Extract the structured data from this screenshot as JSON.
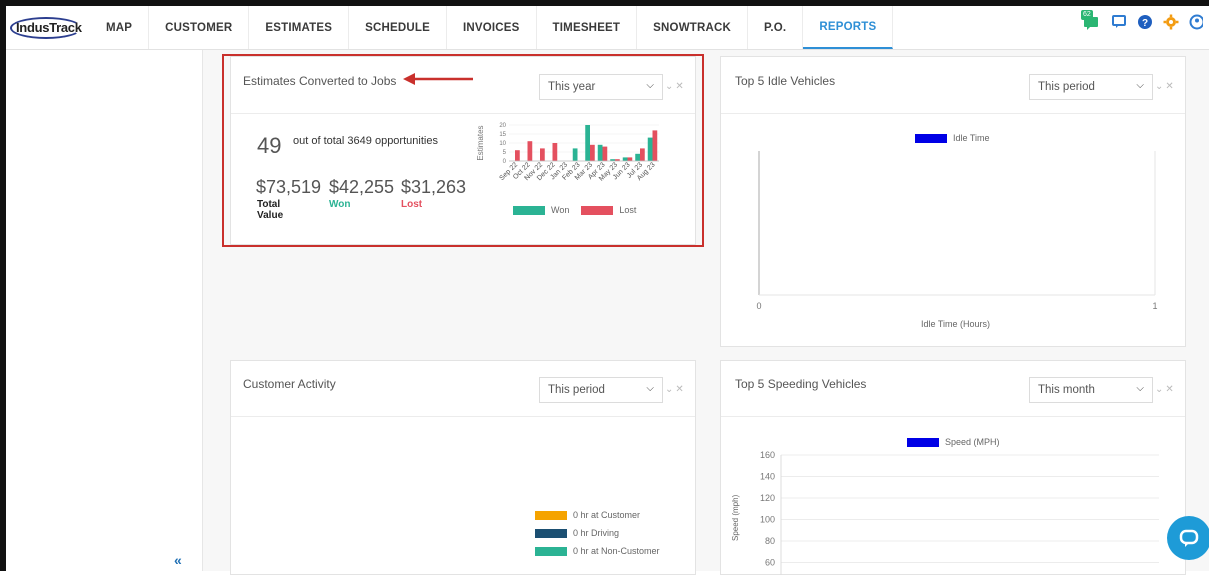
{
  "app": {
    "logo_text": "IndusTrack"
  },
  "nav": {
    "items": [
      {
        "label": "MAP"
      },
      {
        "label": "CUSTOMER"
      },
      {
        "label": "ESTIMATES"
      },
      {
        "label": "SCHEDULE"
      },
      {
        "label": "INVOICES"
      },
      {
        "label": "TIMESHEET"
      },
      {
        "label": "SNOWTRACK"
      },
      {
        "label": "P.O."
      },
      {
        "label": "REPORTS"
      }
    ],
    "active": "REPORTS",
    "notification_count": "62"
  },
  "colors": {
    "accent": "#2e8fd6",
    "won": "#2bb394",
    "lost": "#e4505f",
    "highlight": "#c9302c",
    "bar_blue": "#0000e6"
  },
  "estimates_panel": {
    "title": "Estimates Converted to Jobs",
    "period": "This year",
    "count": "49",
    "count_text": "out of total 3649 opportunities",
    "total_value": "$73,519",
    "won_value": "$42,255",
    "lost_value": "$31,263",
    "total_label": "Total Value",
    "won_label": "Won",
    "lost_label": "Lost"
  },
  "idle_panel": {
    "title": "Top 5 Idle Vehicles",
    "period": "This period",
    "legend": "Idle Time",
    "xlabel": "Idle Time (Hours)"
  },
  "activity_panel": {
    "title": "Customer Activity",
    "period": "This period",
    "legend": [
      {
        "label": "0 hr at Customer",
        "color": "#f5a300"
      },
      {
        "label": "0 hr Driving",
        "color": "#1b4f72"
      },
      {
        "label": "0 hr at Non-Customer",
        "color": "#2bb394"
      }
    ]
  },
  "speeding_panel": {
    "title": "Top 5 Speeding Vehicles",
    "period": "This month",
    "legend": "Speed (MPH)",
    "ylabel": "Speed (mph)"
  },
  "chart_data": [
    {
      "type": "bar",
      "ylabel": "Estimates",
      "categories": [
        "Sep 22",
        "Oct 22",
        "Nov 22",
        "Dec 22",
        "Jan 23",
        "Feb 23",
        "Mar 23",
        "Apr 23",
        "May 23",
        "Jun 23",
        "Jul 23",
        "Aug 23"
      ],
      "series": [
        {
          "name": "Won",
          "color": "#2bb394",
          "values": [
            0,
            0,
            0,
            0,
            0,
            7,
            20,
            9,
            1,
            2,
            4,
            13
          ]
        },
        {
          "name": "Lost",
          "color": "#e4505f",
          "values": [
            6,
            11,
            7,
            10,
            0,
            0,
            9,
            8,
            1,
            2,
            7,
            17
          ]
        }
      ],
      "ylim": [
        0,
        20
      ],
      "yticks": [
        "0",
        "5",
        "10",
        "15",
        "20"
      ]
    },
    {
      "type": "bar",
      "orientation": "horizontal",
      "series": [
        {
          "name": "Idle Time",
          "color": "#0000e6",
          "values": []
        }
      ],
      "xlabel": "Idle Time (Hours)",
      "xlim": [
        0,
        1
      ],
      "xticks": [
        "0",
        "1"
      ]
    },
    {
      "type": "bar",
      "series": [
        {
          "name": "Speed (MPH)",
          "color": "#0000e6",
          "values": []
        }
      ],
      "ylabel": "Speed (mph)",
      "yticks": [
        "60",
        "80",
        "100",
        "120",
        "140",
        "160"
      ]
    }
  ]
}
